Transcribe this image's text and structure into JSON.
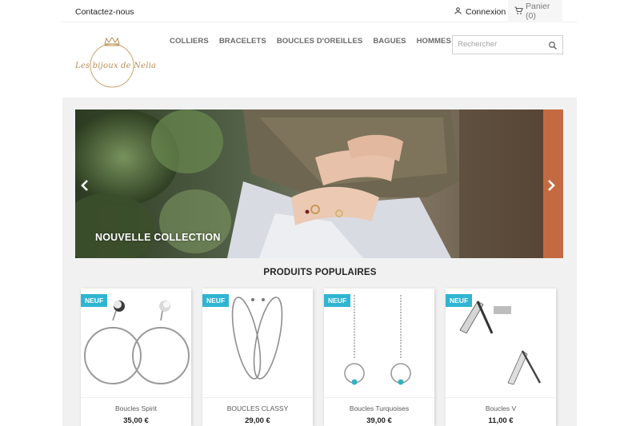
{
  "topbar": {
    "contact": "Contactez-nous",
    "login": "Connexion",
    "cart": "Panier (0)"
  },
  "header": {
    "logo_text": "Les bijoux de Nelia",
    "menu": [
      "COLLIERS",
      "BRACELETS",
      "BOUCLES D'OREILLES",
      "BAGUES",
      "HOMMES"
    ],
    "search_placeholder": "Rechercher"
  },
  "slider": {
    "caption": "NOUVELLE COLLECTION"
  },
  "products": {
    "title": "PRODUITS POPULAIRES",
    "items": [
      {
        "badge": "NEUF",
        "name": "Boucles Spirit",
        "price": "35,00 €"
      },
      {
        "badge": "NEUF",
        "name": "BOUCLES CLASSY",
        "price": "29,00 €"
      },
      {
        "badge": "NEUF",
        "name": "Boucles Turquoises",
        "price": "39,00 €"
      },
      {
        "badge": "NEUF",
        "name": "Boucles V",
        "price": "11,00 €"
      }
    ]
  },
  "colors": {
    "badge": "#2fb5d2",
    "logo_gold": "#b58e55",
    "background_gray": "#f1f1f1"
  },
  "icons": [
    "user-icon",
    "cart-icon",
    "search-icon",
    "chevron-left-icon",
    "chevron-right-icon",
    "crown-icon"
  ]
}
